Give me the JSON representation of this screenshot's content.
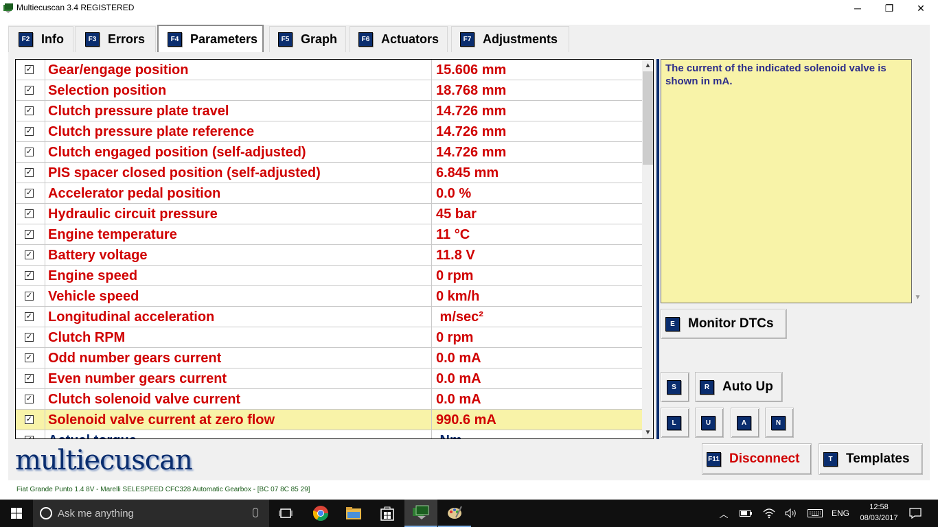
{
  "window": {
    "title": "Multiecuscan 3.4 REGISTERED",
    "minimize_glyph": "─",
    "maximize_glyph": "❐",
    "close_glyph": "✕"
  },
  "tabs": [
    {
      "key": "F2",
      "label": "Info",
      "active": false
    },
    {
      "key": "F3",
      "label": "Errors",
      "active": false
    },
    {
      "key": "F4",
      "label": "Parameters",
      "active": true
    },
    {
      "key": "F5",
      "label": "Graph",
      "active": false
    },
    {
      "key": "F6",
      "label": "Actuators",
      "active": false
    },
    {
      "key": "F7",
      "label": "Adjustments",
      "active": false
    }
  ],
  "parameters": [
    {
      "name": "Gear/engage position",
      "value": "15.606 mm",
      "checked": true
    },
    {
      "name": "Selection position",
      "value": "18.768 mm",
      "checked": true
    },
    {
      "name": "Clutch pressure plate travel",
      "value": "14.726 mm",
      "checked": true
    },
    {
      "name": "Clutch pressure plate reference",
      "value": "14.726 mm",
      "checked": true
    },
    {
      "name": "Clutch engaged position (self-adjusted)",
      "value": "14.726 mm",
      "checked": true
    },
    {
      "name": "PIS spacer closed position (self-adjusted)",
      "value": "6.845 mm",
      "checked": true
    },
    {
      "name": "Accelerator pedal position",
      "value": "0.0 %",
      "checked": true
    },
    {
      "name": "Hydraulic circuit pressure",
      "value": "45 bar",
      "checked": true
    },
    {
      "name": "Engine temperature",
      "value": "11 °C",
      "checked": true
    },
    {
      "name": "Battery voltage",
      "value": "11.8 V",
      "checked": true
    },
    {
      "name": "Engine speed",
      "value": "0 rpm",
      "checked": true
    },
    {
      "name": "Vehicle speed",
      "value": "0 km/h",
      "checked": true
    },
    {
      "name": "Longitudinal acceleration",
      "value": " m/sec²",
      "checked": true
    },
    {
      "name": "Clutch RPM",
      "value": "0 rpm",
      "checked": true
    },
    {
      "name": "Odd number gears current",
      "value": "0.0 mA",
      "checked": true
    },
    {
      "name": "Even number gears current",
      "value": "0.0 mA",
      "checked": true
    },
    {
      "name": "Clutch solenoid valve current",
      "value": "0.0 mA",
      "checked": true
    },
    {
      "name": "Solenoid valve current at zero flow",
      "value": "990.6 mA",
      "checked": true,
      "selected": true
    },
    {
      "name": "Actual torque",
      "value": " Nm",
      "checked": true,
      "partial": true
    }
  ],
  "description": "The current of the indicated solenoid valve is shown in mA.",
  "buttons": {
    "monitor": {
      "key": "E",
      "label": "Monitor DTCs"
    },
    "s": {
      "key": "S"
    },
    "autoup": {
      "key": "R",
      "label": "Auto Up"
    },
    "l": {
      "key": "L"
    },
    "u": {
      "key": "U"
    },
    "a": {
      "key": "A"
    },
    "n": {
      "key": "N"
    },
    "disconnect": {
      "key": "F11",
      "label": "Disconnect"
    },
    "templates": {
      "key": "T",
      "label": "Templates"
    }
  },
  "logo_text": "multiecuscan",
  "status": "Fiat Grande Punto 1.4 8V - Marelli SELESPEED CFC328 Automatic Gearbox - [BC 07 8C 85 29]",
  "taskbar": {
    "search_placeholder": "Ask me anything",
    "language": "ENG",
    "time": "12:58",
    "date": "08/03/2017"
  },
  "colors": {
    "accent_navy": "#0a2d6e",
    "value_red": "#d00000",
    "highlight_yellow": "#f8f3a8"
  }
}
